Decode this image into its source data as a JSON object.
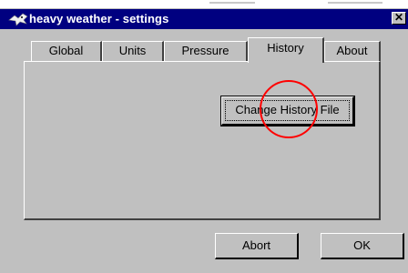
{
  "window": {
    "title": "heavy weather - settings",
    "close_symbol": "✕",
    "icon": "bird-app-icon"
  },
  "tabs": [
    {
      "label": "Global",
      "active": false
    },
    {
      "label": "Units",
      "active": false
    },
    {
      "label": "Pressure",
      "active": false
    },
    {
      "label": "History",
      "active": true
    },
    {
      "label": "About",
      "active": false
    }
  ],
  "history_panel": {
    "change_file_label": "Change History File"
  },
  "footer": {
    "abort_label": "Abort",
    "ok_label": "OK"
  },
  "colors": {
    "titlebar": "#000080",
    "face": "#c0c0c0",
    "annotation_circle": "#ff0000"
  }
}
